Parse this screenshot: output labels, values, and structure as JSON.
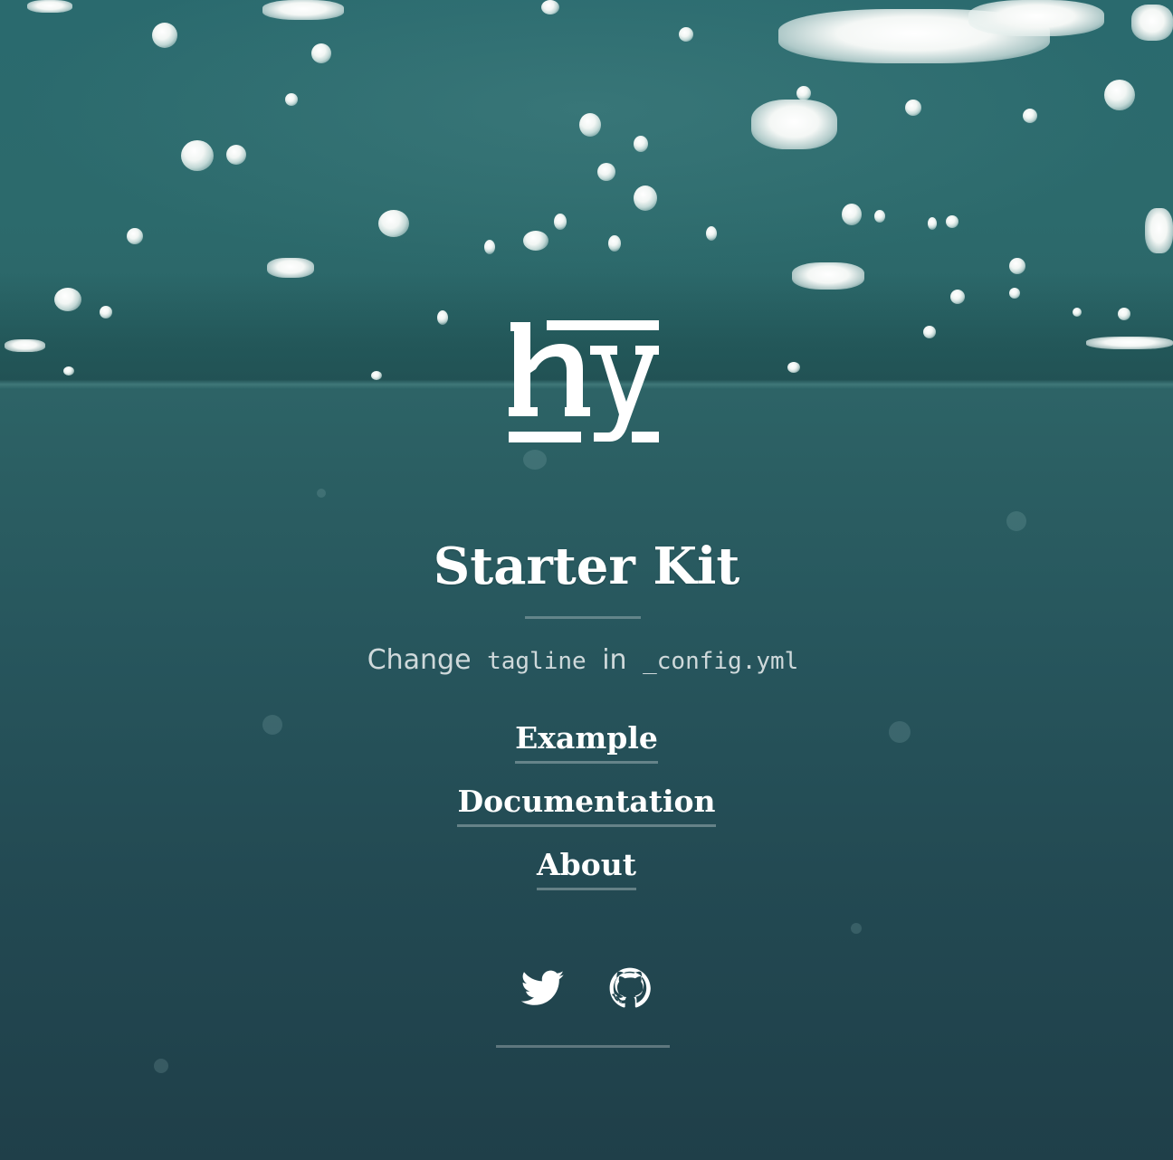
{
  "sidebar": {
    "title": "Starter Kit",
    "tagline": {
      "prefix": "Change",
      "code1": "tagline",
      "middle": "in",
      "code2": "_config.yml"
    },
    "nav": [
      {
        "label": "Example"
      },
      {
        "label": "Documentation"
      },
      {
        "label": "About"
      }
    ],
    "social": [
      {
        "icon": "twitter-icon"
      },
      {
        "icon": "github-icon"
      }
    ]
  },
  "colors": {
    "text": "#ffffff",
    "background": "#24505a"
  }
}
